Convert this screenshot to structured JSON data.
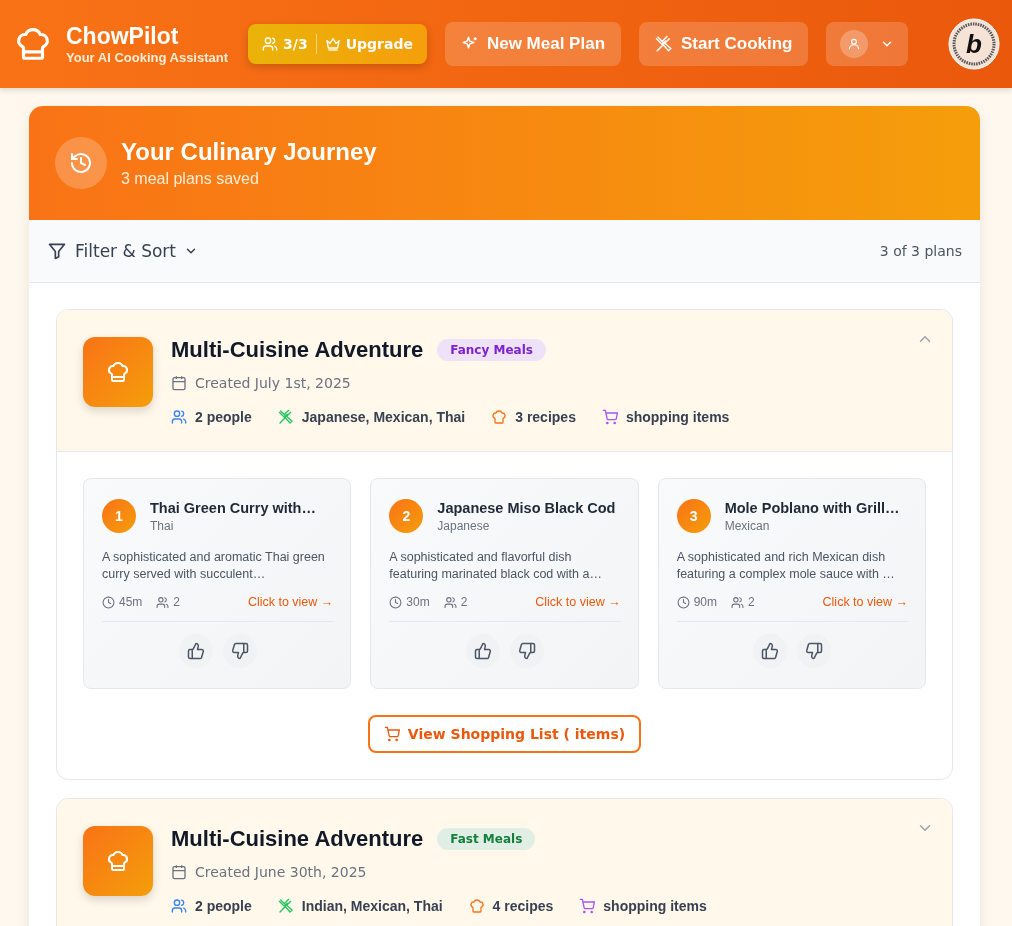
{
  "app": {
    "name": "ChowPilot",
    "tagline": "Your AI Cooking Assistant"
  },
  "header": {
    "usage": "3/3",
    "upgrade": "Upgrade",
    "new_plan": "New Meal Plan",
    "start_cooking": "Start Cooking",
    "badge_letter": "b"
  },
  "journey": {
    "title": "Your Culinary Journey",
    "subtitle": "3 meal plans saved"
  },
  "filter": {
    "label": "Filter & Sort",
    "count": "3 of 3 plans"
  },
  "plans": [
    {
      "title": "Multi-Cuisine Adventure",
      "tag": "Fancy Meals",
      "color": "#7e22ce",
      "created": "Created July 1st, 2025",
      "people": "2 people",
      "cuisines": "Japanese, Mexican, Thai",
      "recipes_count": "3 recipes",
      "shopping": "shopping items",
      "expanded": true,
      "recipes": [
        {
          "number": "1",
          "name": "Thai Green Curry with…",
          "cuisine": "Thai",
          "description": "A sophisticated and aromatic Thai green curry served with succulent…",
          "time": "45m",
          "servings": "2",
          "link": "Click to view →"
        },
        {
          "number": "2",
          "name": "Japanese Miso Black Cod",
          "cuisine": "Japanese",
          "description": "A sophisticated and flavorful dish featuring marinated black cod with a…",
          "time": "30m",
          "servings": "2",
          "link": "Click to view →"
        },
        {
          "number": "3",
          "name": "Mole Poblano with Grill…",
          "cuisine": "Mexican",
          "description": "A sophisticated and rich Mexican dish featuring a complex mole sauce with …",
          "time": "90m",
          "servings": "2",
          "link": "Click to view →"
        }
      ],
      "shopping_button": "View Shopping List ( items)"
    },
    {
      "title": "Multi-Cuisine Adventure",
      "tag": "Fast Meals",
      "color": "#15803d",
      "created": "Created June 30th, 2025",
      "people": "2 people",
      "cuisines": "Indian, Mexican, Thai",
      "recipes_count": "4 recipes",
      "shopping": "shopping items",
      "expanded": false
    }
  ]
}
